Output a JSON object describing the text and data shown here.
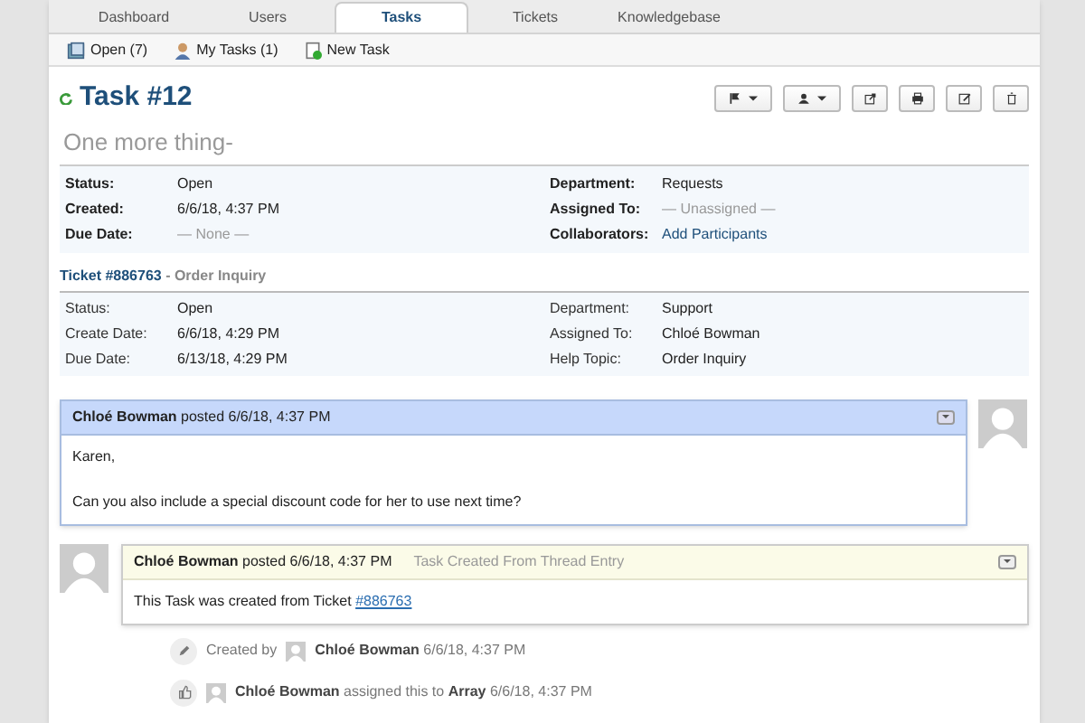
{
  "tabs": [
    {
      "label": "Dashboard",
      "selected": false
    },
    {
      "label": "Users",
      "selected": false
    },
    {
      "label": "Tasks",
      "selected": true
    },
    {
      "label": "Tickets",
      "selected": false
    },
    {
      "label": "Knowledgebase",
      "selected": false
    }
  ],
  "subnav": [
    {
      "kind": "open",
      "label": "Open (7)"
    },
    {
      "kind": "mine",
      "label": "My Tasks (1)"
    },
    {
      "kind": "new",
      "label": "New Task"
    }
  ],
  "task": {
    "title": "Task #12",
    "subject": "One more thing-",
    "actions": [
      {
        "kind": "flag",
        "dropdown": true
      },
      {
        "kind": "user",
        "dropdown": true
      },
      {
        "kind": "share",
        "dropdown": false
      },
      {
        "kind": "print",
        "dropdown": false
      },
      {
        "kind": "edit",
        "dropdown": false
      },
      {
        "kind": "trash",
        "dropdown": false
      }
    ],
    "fields_left": [
      {
        "label": "Status:",
        "value": "Open",
        "kind": "plain"
      },
      {
        "label": "Created:",
        "value": "6/6/18, 4:37 PM",
        "kind": "plain"
      },
      {
        "label": "Due Date:",
        "value": "— None —",
        "kind": "muted"
      }
    ],
    "fields_right": [
      {
        "label": "Department:",
        "value": "Requests",
        "kind": "plain"
      },
      {
        "label": "Assigned To:",
        "value": "— Unassigned —",
        "kind": "muted"
      },
      {
        "label": "Collaborators:",
        "value": "Add Participants",
        "kind": "link"
      }
    ]
  },
  "ticket": {
    "link": "Ticket #886763",
    "separator": " - ",
    "subject": "Order Inquiry",
    "fields_left": [
      {
        "label": "Status:",
        "value": "Open"
      },
      {
        "label": "Create Date:",
        "value": "6/6/18, 4:29 PM"
      },
      {
        "label": "Due Date:",
        "value": "6/13/18, 4:29 PM"
      }
    ],
    "fields_right": [
      {
        "label": "Department:",
        "value": "Support"
      },
      {
        "label": "Assigned To:",
        "value": "Chloé Bowman"
      },
      {
        "label": "Help Topic:",
        "value": "Order Inquiry"
      }
    ]
  },
  "thread": [
    {
      "kind": "message",
      "header": "**Chloé Bowman** posted 6/6/18, 4:37 PM",
      "body": [
        "Karen,",
        "Can you also include a special discount code for her to use next time?"
      ]
    },
    {
      "kind": "note",
      "header": "**Chloé Bowman** posted 6/6/18, 4:37 PM",
      "tag": "Task Created From Thread Entry",
      "body_text": "This Task was created from Ticket ",
      "body_link": "#886763"
    }
  ],
  "events": [
    {
      "kind": "created",
      "before": "Created by",
      "text": "**Chloé Bowman** 6/6/18, 4:37 PM"
    },
    {
      "kind": "assigned",
      "text": "**Chloé Bowman** assigned this to **Array** 6/6/18, 4:37 PM"
    }
  ]
}
